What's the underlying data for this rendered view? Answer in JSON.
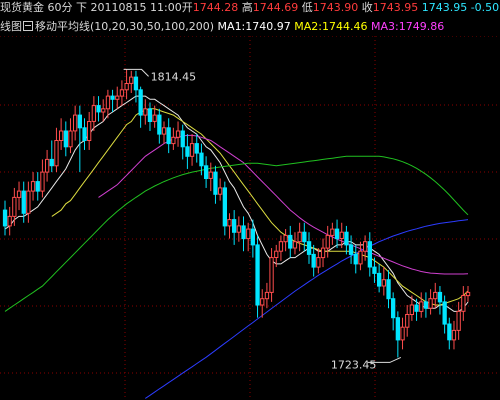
{
  "header": {
    "symbol": "现货黄金",
    "period": "60分",
    "arrow": "下",
    "date": "20110815",
    "time": "11:00",
    "open_label": "开",
    "open_value": "1744.28",
    "high_label": "高",
    "high_value": "1744.69",
    "low_label": "低",
    "low_value": "1743.90",
    "close_label": "收",
    "close_value": "1743.95",
    "change_value": "1743.95 -0.50"
  },
  "ma_bar": {
    "chart_name": "线图",
    "indicator_name": "移动平均线",
    "params": "(10,20,30,50,100,200)",
    "ma1": "MA1:1740.97",
    "ma2": "MA2:1744.46",
    "ma3": "MA3:1749.86",
    "ma1_color": "#ffffff",
    "ma2_color": "#ffff00",
    "ma3_color": "#ff40ff"
  },
  "colors": {
    "up": "#ff4d4d",
    "down": "#00e5ff",
    "grid": "#8b0000",
    "ma_white": "#e8e8e8",
    "ma_yellow": "#dcdc40",
    "ma_magenta": "#d040d0",
    "ma_green": "#20c020",
    "ma_blue": "#2c3cff",
    "ma_blue2": "#1a60ff"
  },
  "chart_data": {
    "type": "candlestick",
    "title": "",
    "xlabel": "",
    "ylabel": "",
    "ylim": [
      1710,
      1825
    ],
    "annotations": [
      {
        "text": "1814.45",
        "value": 1814.45
      },
      {
        "text": "1723.45",
        "value": 1723.45
      }
    ],
    "candles": [
      [
        1770.0,
        1765.0,
        1773.0,
        1762.0
      ],
      [
        1765.0,
        1768.0,
        1771.0,
        1762.0
      ],
      [
        1768.0,
        1774.0,
        1777.0,
        1765.0
      ],
      [
        1774.0,
        1776.0,
        1779.0,
        1770.0
      ],
      [
        1776.0,
        1769.0,
        1779.0,
        1766.0
      ],
      [
        1769.0,
        1776.0,
        1779.0,
        1766.0
      ],
      [
        1776.0,
        1779.0,
        1782.0,
        1773.0
      ],
      [
        1779.0,
        1776.0,
        1782.0,
        1773.0
      ],
      [
        1776.0,
        1782.0,
        1786.0,
        1774.0
      ],
      [
        1782.0,
        1786.0,
        1789.0,
        1779.0
      ],
      [
        1786.0,
        1784.0,
        1792.0,
        1782.0
      ],
      [
        1784.0,
        1792.0,
        1796.0,
        1782.0
      ],
      [
        1792.0,
        1795.0,
        1799.0,
        1789.0
      ],
      [
        1795.0,
        1790.0,
        1798.0,
        1787.0
      ],
      [
        1790.0,
        1795.0,
        1799.0,
        1788.0
      ],
      [
        1795.0,
        1800.0,
        1803.0,
        1792.0
      ],
      [
        1800.0,
        1796.0,
        1803.0,
        1782.0
      ],
      [
        1796.0,
        1792.0,
        1799.0,
        1789.0
      ],
      [
        1792.0,
        1798.0,
        1801.0,
        1789.0
      ],
      [
        1798.0,
        1803.0,
        1806.0,
        1795.0
      ],
      [
        1803.0,
        1801.0,
        1806.0,
        1798.0
      ],
      [
        1801.0,
        1802.0,
        1805.0,
        1798.0
      ],
      [
        1802.0,
        1806.0,
        1808.0,
        1799.0
      ],
      [
        1806.0,
        1805.0,
        1808.0,
        1801.0
      ],
      [
        1805.0,
        1806.0,
        1809.0,
        1802.0
      ],
      [
        1806.0,
        1808.0,
        1811.0,
        1803.0
      ],
      [
        1808.0,
        1810.0,
        1814.45,
        1805.0
      ],
      [
        1810.0,
        1812.0,
        1814.0,
        1807.0
      ],
      [
        1812.0,
        1808.0,
        1814.0,
        1804.0
      ],
      [
        1808.0,
        1800.0,
        1809.0,
        1796.0
      ],
      [
        1800.0,
        1802.0,
        1805.0,
        1797.0
      ],
      [
        1802.0,
        1798.0,
        1804.0,
        1795.0
      ],
      [
        1798.0,
        1800.0,
        1803.0,
        1796.0
      ],
      [
        1800.0,
        1794.0,
        1802.0,
        1791.0
      ],
      [
        1794.0,
        1796.0,
        1798.0,
        1791.0
      ],
      [
        1796.0,
        1791.0,
        1799.0,
        1788.0
      ],
      [
        1791.0,
        1793.0,
        1796.0,
        1789.0
      ],
      [
        1793.0,
        1795.0,
        1798.0,
        1790.0
      ],
      [
        1795.0,
        1790.0,
        1797.0,
        1786.0
      ],
      [
        1790.0,
        1787.0,
        1794.0,
        1783.0
      ],
      [
        1787.0,
        1791.0,
        1794.0,
        1784.0
      ],
      [
        1791.0,
        1788.0,
        1794.0,
        1785.0
      ],
      [
        1788.0,
        1784.0,
        1791.0,
        1781.0
      ],
      [
        1784.0,
        1780.0,
        1787.0,
        1777.0
      ],
      [
        1780.0,
        1782.0,
        1785.0,
        1776.0
      ],
      [
        1782.0,
        1775.0,
        1784.0,
        1772.0
      ],
      [
        1775.0,
        1777.0,
        1780.0,
        1773.0
      ],
      [
        1777.0,
        1765.0,
        1779.0,
        1762.0
      ],
      [
        1765.0,
        1767.0,
        1769.0,
        1761.0
      ],
      [
        1767.0,
        1763.0,
        1770.0,
        1759.0
      ],
      [
        1763.0,
        1765.0,
        1768.0,
        1760.0
      ],
      [
        1765.0,
        1761.0,
        1768.0,
        1757.0
      ],
      [
        1761.0,
        1764.0,
        1766.0,
        1757.0
      ],
      [
        1764.0,
        1759.0,
        1767.0,
        1755.0
      ],
      [
        1759.0,
        1740.0,
        1762.0,
        1736.0
      ],
      [
        1740.0,
        1742.0,
        1745.0,
        1736.0
      ],
      [
        1742.0,
        1744.0,
        1747.0,
        1739.0
      ],
      [
        1744.0,
        1755.0,
        1758.0,
        1741.0
      ],
      [
        1755.0,
        1757.0,
        1759.0,
        1752.0
      ],
      [
        1757.0,
        1760.0,
        1762.0,
        1754.0
      ],
      [
        1760.0,
        1762.0,
        1764.0,
        1757.0
      ],
      [
        1762.0,
        1758.0,
        1765.0,
        1755.0
      ],
      [
        1758.0,
        1760.0,
        1763.0,
        1756.0
      ],
      [
        1760.0,
        1763.0,
        1766.0,
        1757.0
      ],
      [
        1763.0,
        1760.0,
        1766.0,
        1757.0
      ],
      [
        1760.0,
        1756.0,
        1763.0,
        1753.0
      ],
      [
        1756.0,
        1752.0,
        1759.0,
        1749.0
      ],
      [
        1752.0,
        1755.0,
        1758.0,
        1750.0
      ],
      [
        1755.0,
        1758.0,
        1761.0,
        1752.0
      ],
      [
        1758.0,
        1762.0,
        1765.0,
        1755.0
      ],
      [
        1762.0,
        1764.0,
        1766.0,
        1759.0
      ],
      [
        1764.0,
        1761.0,
        1767.0,
        1758.0
      ],
      [
        1761.0,
        1763.0,
        1766.0,
        1758.0
      ],
      [
        1763.0,
        1759.0,
        1765.0,
        1756.0
      ],
      [
        1759.0,
        1756.0,
        1762.0,
        1753.0
      ],
      [
        1756.0,
        1753.0,
        1759.0,
        1750.0
      ],
      [
        1753.0,
        1757.0,
        1760.0,
        1751.0
      ],
      [
        1757.0,
        1760.0,
        1762.0,
        1754.0
      ],
      [
        1760.0,
        1752.0,
        1763.0,
        1749.0
      ],
      [
        1752.0,
        1750.0,
        1755.0,
        1747.0
      ],
      [
        1750.0,
        1746.0,
        1753.0,
        1744.0
      ],
      [
        1746.0,
        1748.0,
        1752.0,
        1743.0
      ],
      [
        1748.0,
        1742.0,
        1751.0,
        1739.0
      ],
      [
        1742.0,
        1736.0,
        1744.0,
        1732.0
      ],
      [
        1736.0,
        1729.0,
        1738.0,
        1723.45
      ],
      [
        1729.0,
        1733.0,
        1736.0,
        1726.0
      ],
      [
        1733.0,
        1737.0,
        1740.0,
        1730.0
      ],
      [
        1737.0,
        1740.0,
        1743.0,
        1735.0
      ],
      [
        1740.0,
        1738.0,
        1742.0,
        1735.0
      ],
      [
        1738.0,
        1741.0,
        1744.0,
        1736.0
      ],
      [
        1741.0,
        1739.0,
        1744.0,
        1736.0
      ],
      [
        1739.0,
        1742.0,
        1745.0,
        1737.0
      ],
      [
        1742.0,
        1744.0,
        1747.0,
        1739.0
      ],
      [
        1744.0,
        1741.0,
        1746.0,
        1737.0
      ],
      [
        1741.0,
        1734.0,
        1743.0,
        1731.0
      ],
      [
        1734.0,
        1729.0,
        1736.0,
        1726.0
      ],
      [
        1729.0,
        1732.0,
        1735.0,
        1726.0
      ],
      [
        1732.0,
        1738.0,
        1741.0,
        1729.0
      ],
      [
        1738.0,
        1743.0,
        1746.0,
        1735.0
      ],
      [
        1743.0,
        1744.0,
        1746.0,
        1741.0
      ]
    ],
    "ma_series": [
      {
        "color": "#e8e8e8",
        "values": [
          1764.0,
          1765.0,
          1767.0,
          1768.0,
          1768.0,
          1769.0,
          1770.0,
          1771.0,
          1773.0,
          1775.0,
          1777.0,
          1779.0,
          1781.0,
          1783.0,
          1786.0,
          1789.0,
          1791.0,
          1792.0,
          1794.0,
          1796.0,
          1797.0,
          1798.0,
          1800.0,
          1801.0,
          1802.0,
          1803.0,
          1804.0,
          1805.0,
          1806.0,
          1806.0,
          1806.0,
          1805.0,
          1805.0,
          1804.0,
          1803.0,
          1802.0,
          1801.0,
          1800.0,
          1798.0,
          1796.0,
          1795.0,
          1794.0,
          1792.0,
          1790.0,
          1789.0,
          1787.0,
          1785.0,
          1782.0,
          1779.0,
          1777.0,
          1774.0,
          1771.0,
          1769.0,
          1766.0,
          1762.0,
          1759.0,
          1756.0,
          1754.0,
          1753.0,
          1753.0,
          1754.0,
          1755.0,
          1755.0,
          1756.0,
          1757.0,
          1758.0,
          1758.0,
          1757.0,
          1757.0,
          1757.0,
          1758.0,
          1759.0,
          1759.0,
          1760.0,
          1760.0,
          1759.0,
          1759.0,
          1759.0,
          1758.0,
          1757.0,
          1756.0,
          1754.0,
          1752.0,
          1750.0,
          1747.0,
          1745.0,
          1743.0,
          1742.0,
          1741.0,
          1740.0,
          1739.0,
          1739.0,
          1739.0,
          1740.0,
          1740.0,
          1739.0,
          1738.0,
          1738.0,
          1739.0,
          1740.97
        ]
      },
      {
        "color": "#dcdc40",
        "values": [
          null,
          null,
          null,
          null,
          null,
          null,
          null,
          null,
          null,
          null,
          1768.0,
          1769.0,
          1770.0,
          1772.0,
          1773.0,
          1775.0,
          1777.0,
          1779.0,
          1781.0,
          1783.0,
          1785.0,
          1787.0,
          1789.0,
          1791.0,
          1793.0,
          1795.0,
          1797.0,
          1798.0,
          1800.0,
          1801.0,
          1801.5,
          1802.0,
          1802.0,
          1801.5,
          1801.0,
          1800.5,
          1800.0,
          1799.0,
          1798.0,
          1797.0,
          1796.0,
          1795.0,
          1794.0,
          1792.5,
          1791.0,
          1789.5,
          1788.0,
          1786.0,
          1784.0,
          1782.0,
          1780.0,
          1778.0,
          1776.0,
          1774.0,
          1772.0,
          1770.0,
          1768.0,
          1766.0,
          1764.5,
          1763.0,
          1762.0,
          1761.0,
          1760.0,
          1759.5,
          1759.0,
          1758.5,
          1758.0,
          1757.5,
          1757.0,
          1757.0,
          1757.0,
          1757.0,
          1757.0,
          1757.0,
          1757.0,
          1756.5,
          1756.0,
          1755.5,
          1755.0,
          1754.0,
          1753.0,
          1752.0,
          1750.5,
          1749.0,
          1747.5,
          1746.0,
          1745.0,
          1744.0,
          1743.0,
          1742.0,
          1741.0,
          1740.5,
          1740.0,
          1740.0,
          1740.5,
          1741.0,
          1741.5,
          1742.0,
          1743.0,
          1744.46
        ]
      },
      {
        "color": "#d040d0",
        "values": [
          null,
          null,
          null,
          null,
          null,
          null,
          null,
          null,
          null,
          null,
          null,
          null,
          null,
          null,
          null,
          null,
          null,
          null,
          null,
          null,
          1774.0,
          1775.0,
          1776.0,
          1777.0,
          1778.0,
          1779.5,
          1781.0,
          1782.5,
          1784.0,
          1785.5,
          1787.0,
          1788.0,
          1789.0,
          1790.0,
          1791.0,
          1791.8,
          1792.5,
          1793.0,
          1793.4,
          1793.6,
          1793.6,
          1793.4,
          1793.0,
          1792.5,
          1792.0,
          1791.0,
          1790.0,
          1789.0,
          1788.0,
          1787.0,
          1786.0,
          1785.0,
          1783.5,
          1782.0,
          1780.5,
          1779.0,
          1777.5,
          1776.0,
          1774.5,
          1773.0,
          1771.5,
          1770.0,
          1768.8,
          1767.6,
          1766.5,
          1765.5,
          1764.6,
          1763.8,
          1763.0,
          1762.2,
          1761.5,
          1760.8,
          1760.2,
          1759.6,
          1759.0,
          1758.4,
          1757.8,
          1757.2,
          1756.6,
          1756.0,
          1755.4,
          1754.8,
          1754.2,
          1753.6,
          1753.0,
          1752.4,
          1751.9,
          1751.4,
          1751.0,
          1750.6,
          1750.3,
          1750.1,
          1750.0,
          1749.9,
          1749.8,
          1749.8,
          1749.8,
          1749.8,
          1749.8,
          1749.86
        ]
      },
      {
        "color": "#20c020",
        "values": [
          1738.0,
          1739.0,
          1740.0,
          1741.0,
          1742.0,
          1743.0,
          1744.0,
          1745.0,
          1746.0,
          1747.5,
          1749.0,
          1750.5,
          1752.0,
          1753.5,
          1755.0,
          1756.5,
          1758.0,
          1759.5,
          1761.0,
          1762.5,
          1764.0,
          1765.5,
          1767.0,
          1768.3,
          1769.6,
          1770.8,
          1772.0,
          1773.0,
          1774.0,
          1775.0,
          1776.0,
          1776.8,
          1777.6,
          1778.3,
          1779.0,
          1779.6,
          1780.2,
          1780.7,
          1781.2,
          1781.6,
          1782.0,
          1782.3,
          1782.6,
          1782.9,
          1783.2,
          1783.4,
          1783.6,
          1783.8,
          1784.0,
          1784.2,
          1784.4,
          1784.6,
          1784.8,
          1784.8,
          1784.8,
          1784.6,
          1784.4,
          1784.2,
          1784.0,
          1784.2,
          1784.4,
          1784.6,
          1784.8,
          1785.0,
          1785.2,
          1785.4,
          1785.6,
          1785.8,
          1786.0,
          1786.2,
          1786.4,
          1786.6,
          1786.8,
          1787.0,
          1787.0,
          1787.0,
          1787.0,
          1787.0,
          1787.0,
          1787.0,
          1787.0,
          1786.8,
          1786.5,
          1786.2,
          1785.8,
          1785.3,
          1784.7,
          1784.0,
          1783.2,
          1782.3,
          1781.3,
          1780.2,
          1779.0,
          1777.7,
          1776.3,
          1774.8,
          1773.2,
          1771.6,
          1770.0,
          1768.5
        ]
      },
      {
        "color": "#2c3cff",
        "values": [
          null,
          null,
          null,
          null,
          null,
          null,
          null,
          null,
          null,
          null,
          null,
          null,
          null,
          null,
          null,
          null,
          null,
          null,
          null,
          null,
          null,
          null,
          null,
          null,
          null,
          null,
          null,
          null,
          null,
          null,
          1710.5,
          1711.5,
          1712.5,
          1713.5,
          1714.5,
          1715.5,
          1716.5,
          1717.5,
          1718.5,
          1719.5,
          1720.5,
          1721.5,
          1722.5,
          1723.5,
          1724.6,
          1725.7,
          1726.8,
          1727.9,
          1729.0,
          1730.1,
          1731.2,
          1732.3,
          1733.4,
          1734.5,
          1735.6,
          1736.7,
          1737.8,
          1738.9,
          1740.0,
          1741.1,
          1742.2,
          1743.3,
          1744.4,
          1745.4,
          1746.4,
          1747.4,
          1748.4,
          1749.4,
          1750.3,
          1751.2,
          1752.1,
          1753.0,
          1753.9,
          1754.7,
          1755.5,
          1756.3,
          1757.1,
          1757.9,
          1758.6,
          1759.3,
          1760.0,
          1760.6,
          1761.2,
          1761.8,
          1762.3,
          1762.8,
          1763.3,
          1763.7,
          1764.1,
          1764.5,
          1764.9,
          1765.2,
          1765.5,
          1765.8,
          1766.0,
          1766.2,
          1766.4,
          1766.6,
          1766.8,
          1767.0
        ]
      }
    ]
  }
}
